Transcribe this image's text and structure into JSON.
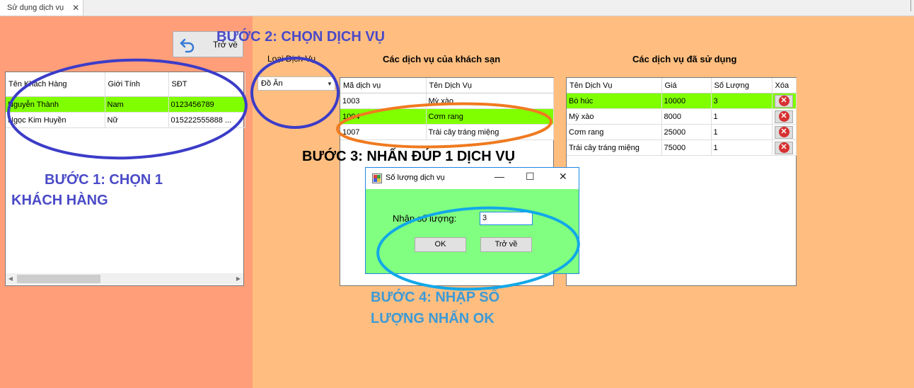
{
  "window": {
    "tab_title": "Sử dụng dịch vụ",
    "tab_close": "✕"
  },
  "colors": {
    "left_bg": "#ff9e78",
    "right_bg": "#ffbe80",
    "selected_row": "#80ff00",
    "dialog_bg": "#80ff80",
    "step_purple": "#4a4ac8",
    "step_cyan": "#3d9ad6"
  },
  "back_button": {
    "label": "Trở về",
    "icon": "back-arrow-icon"
  },
  "customers": {
    "columns": [
      "Tên Khách Hàng",
      "Giới Tính",
      "SĐT"
    ],
    "rows": [
      [
        "Nguyễn Thành",
        "Nam",
        "0123456789"
      ],
      [
        "Ngọc Kim Huyền",
        "Nữ",
        "015222555888 ..."
      ]
    ],
    "selected_index": 0
  },
  "service_type": {
    "label": "Loại Dịch Vụ",
    "value": "Đồ Ăn"
  },
  "hotel_services": {
    "title": "Các dịch vụ của khách sạn",
    "columns": [
      "Mã dịch vụ",
      "Tên Dịch Vụ"
    ],
    "rows": [
      [
        "1003",
        "Mỳ xào"
      ],
      [
        "1004",
        "Cơm rang"
      ],
      [
        "1007",
        "Trái cây tráng miệng"
      ]
    ],
    "selected_index": 1
  },
  "used_services": {
    "title": "Các dịch vụ đã sử dụng",
    "columns": [
      "Tên Dịch Vụ",
      "Giá",
      "Số Lượng",
      "Xóa"
    ],
    "rows": [
      [
        "Bò húc",
        "10000",
        "3"
      ],
      [
        "Mỳ xào",
        "8000",
        "1"
      ],
      [
        "Cơm rang",
        "25000",
        "1"
      ],
      [
        "Trái cây tráng miệng",
        "75000",
        "1"
      ]
    ],
    "selected_index": 0,
    "delete_icon": "delete-x-icon"
  },
  "steps": {
    "step1_line1": "BƯỚC 1: CHỌN 1",
    "step1_line2": "KHÁCH HÀNG",
    "step2": "BƯỚC 2: CHỌN DỊCH VỤ",
    "step3": "BƯỚC 3: NHẤN ĐÚP 1 DỊCH VỤ",
    "step4_line1": "BƯỚC 4: NHẬP SỐ",
    "step4_line2": "LƯỢNG NHẤN OK"
  },
  "dialog": {
    "title": "Số lượng dịch vụ",
    "minimize": "—",
    "maximize": "☐",
    "close": "✕",
    "qty_label": "Nhập số lượng:",
    "qty_value": "3",
    "ok": "OK",
    "back": "Trở về"
  }
}
